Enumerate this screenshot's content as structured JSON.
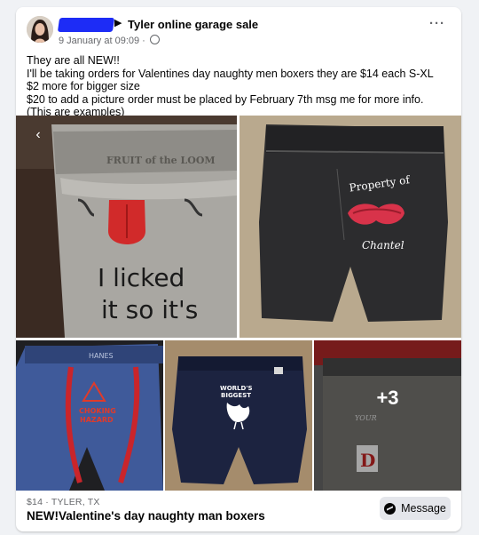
{
  "post": {
    "group_arrow": "▶",
    "group_name": "Tyler online garage sale",
    "timestamp": "9 January at 09:09 ·",
    "more_label": "···",
    "lines": [
      "They are all NEW!!",
      "I'll be taking orders for Valentines day naughty men boxers they are $14 each S-XL",
      "$2 more for bigger size",
      "$20 to add a picture order must be placed by February 7th msg me for more info.",
      "(This are examples)"
    ]
  },
  "photos": {
    "prev_icon": "‹",
    "more_count": "+3",
    "p1": {
      "brand": "FRUIT of the LOOM",
      "line1": "I licked",
      "line2": "it so it's"
    },
    "p2": {
      "line1": "Property of",
      "line2": "Chantel"
    },
    "p3": {
      "brand": "HANES",
      "line1": "CHOKING",
      "line2": "HAZARD"
    },
    "p4": {
      "line1": "WORLD'S",
      "line2": "BIGGEST"
    },
    "p5": {
      "line1": "YOUR",
      "line2": "D"
    }
  },
  "listing": {
    "meta": "$14 · TYLER, TX",
    "title": "NEW!Valentine's day naughty man boxers",
    "message_button": "Message"
  },
  "colors": {
    "redaction": "#1d2cf6",
    "message_button_bg": "#e4e6eb",
    "meta_gray": "#65676b"
  }
}
